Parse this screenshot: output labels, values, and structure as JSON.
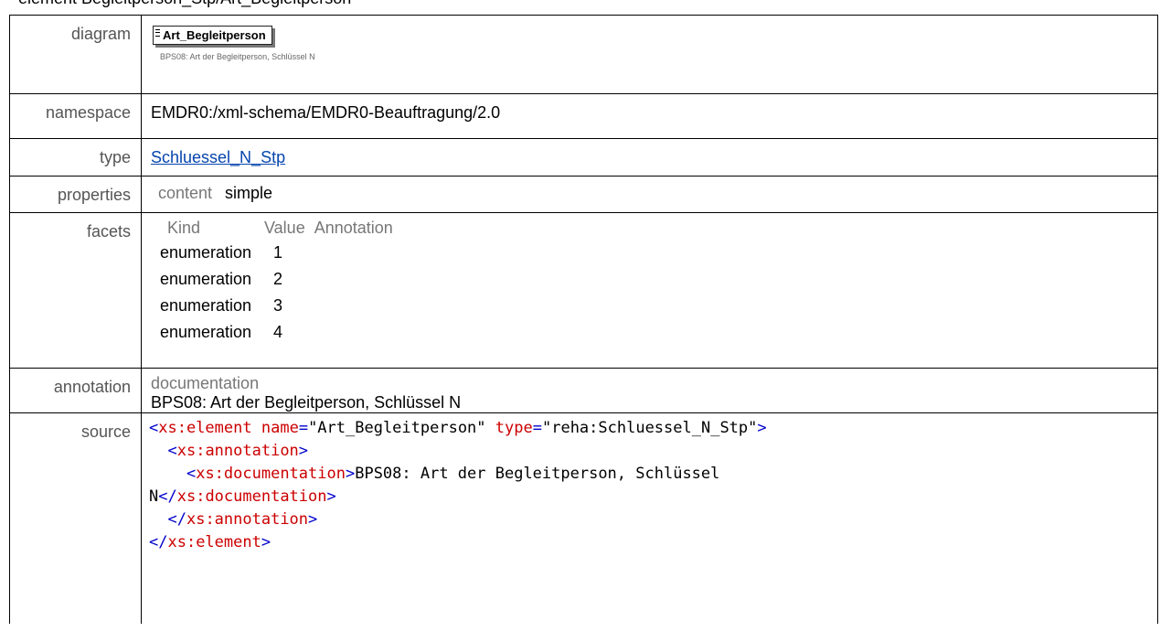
{
  "page_title": "element Begleitperson_Stp/Art_Begleitperson",
  "rows": {
    "diagram": {
      "label": "diagram",
      "box_name": "Art_Begleitperson",
      "doc": "BPS08: Art der Begleitperson, Schlüssel N"
    },
    "namespace": {
      "label": "namespace",
      "value": "EMDR0:/xml-schema/EMDR0-Beauftragung/2.0"
    },
    "type": {
      "label": "type",
      "value": "Schluessel_N_Stp"
    },
    "properties": {
      "label": "properties",
      "key": "content",
      "value": "simple"
    },
    "facets": {
      "label": "facets",
      "headers": [
        "Kind",
        "Value",
        "Annotation"
      ],
      "items": [
        {
          "kind": "enumeration",
          "value": "1"
        },
        {
          "kind": "enumeration",
          "value": "2"
        },
        {
          "kind": "enumeration",
          "value": "3"
        },
        {
          "kind": "enumeration",
          "value": "4"
        }
      ]
    },
    "annotation": {
      "label": "annotation",
      "key": "documentation",
      "value": "BPS08: Art der Begleitperson, Schlüssel N"
    },
    "source": {
      "label": "source",
      "element_open": "xs:element",
      "name_attr": "name",
      "name_val": "\"Art_Begleitperson\"",
      "type_attr": "type",
      "type_val": "\"reha:Schluessel_N_Stp\"",
      "annotation_tag": "xs:annotation",
      "documentation_tag": "xs:documentation",
      "doc_text_1": "BPS08: Art der Begleitperson, Schlüssel",
      "doc_text_2": "N"
    }
  }
}
